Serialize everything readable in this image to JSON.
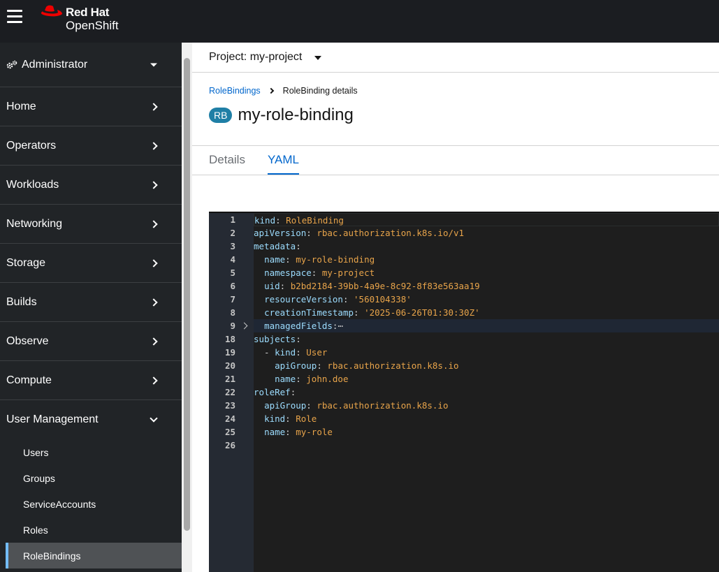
{
  "masthead": {
    "brand_line1": "Red Hat",
    "brand_line2": "OpenShift"
  },
  "sidebar": {
    "perspective": "Administrator",
    "items": [
      {
        "label": "Home"
      },
      {
        "label": "Operators"
      },
      {
        "label": "Workloads"
      },
      {
        "label": "Networking"
      },
      {
        "label": "Storage"
      },
      {
        "label": "Builds"
      },
      {
        "label": "Observe"
      },
      {
        "label": "Compute"
      }
    ],
    "expanded_section": "User Management",
    "sub_items": [
      "Users",
      "Groups",
      "ServiceAccounts",
      "Roles",
      "RoleBindings"
    ],
    "active_sub_item": "RoleBindings"
  },
  "project_bar": {
    "label": "Project: my-project"
  },
  "breadcrumb": {
    "parent": "RoleBindings",
    "current": "RoleBinding details"
  },
  "page": {
    "badge": "RB",
    "title": "my-role-binding"
  },
  "tabs": [
    {
      "label": "Details",
      "active": false
    },
    {
      "label": "YAML",
      "active": true
    }
  ],
  "editor": {
    "lines": [
      {
        "n": "1",
        "indent": 0,
        "key": "kind",
        "value": "RoleBinding"
      },
      {
        "n": "2",
        "indent": 0,
        "key": "apiVersion",
        "value": "rbac.authorization.k8s.io/v1"
      },
      {
        "n": "3",
        "indent": 0,
        "key": "metadata",
        "value": ""
      },
      {
        "n": "4",
        "indent": 1,
        "key": "name",
        "value": "my-role-binding"
      },
      {
        "n": "5",
        "indent": 1,
        "key": "namespace",
        "value": "my-project"
      },
      {
        "n": "6",
        "indent": 1,
        "key": "uid",
        "value": "b2bd2184-39bb-4a9e-8c92-8f83e563aa19"
      },
      {
        "n": "7",
        "indent": 1,
        "key": "resourceVersion",
        "value": "'560104338'"
      },
      {
        "n": "8",
        "indent": 1,
        "key": "creationTimestamp",
        "value": "'2025-06-26T01:30:30Z'"
      },
      {
        "n": "9",
        "indent": 1,
        "key": "managedFields",
        "value": "",
        "folded": true
      },
      {
        "n": "18",
        "indent": 0,
        "key": "subjects",
        "value": ""
      },
      {
        "n": "19",
        "indent": 1,
        "dash": true,
        "key": "kind",
        "value": "User"
      },
      {
        "n": "20",
        "indent": 2,
        "key": "apiGroup",
        "value": "rbac.authorization.k8s.io"
      },
      {
        "n": "21",
        "indent": 2,
        "key": "name",
        "value": "john.doe"
      },
      {
        "n": "22",
        "indent": 0,
        "key": "roleRef",
        "value": ""
      },
      {
        "n": "23",
        "indent": 1,
        "key": "apiGroup",
        "value": "rbac.authorization.k8s.io"
      },
      {
        "n": "24",
        "indent": 1,
        "key": "kind",
        "value": "Role"
      },
      {
        "n": "25",
        "indent": 1,
        "key": "name",
        "value": "my-role"
      },
      {
        "n": "26",
        "indent": 0,
        "key": "",
        "value": ""
      }
    ],
    "fold_ellipsis": "⋯"
  },
  "colors": {
    "masthead": "#1b1d21",
    "sidebar": "#212427",
    "accent": "#0066cc",
    "badge": "#1f7fa6",
    "yaml_key": "#9cdcfe",
    "yaml_value": "#ce9178"
  }
}
